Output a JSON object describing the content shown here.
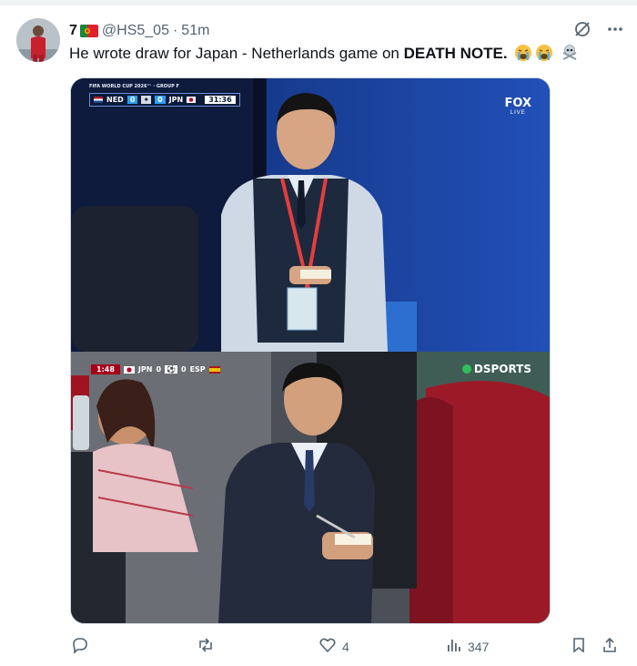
{
  "colors": {
    "text": "#0f1419",
    "muted": "#536471",
    "border": "#cfd9de"
  },
  "post": {
    "display_name": "7",
    "handle": "@HS5_05",
    "separator": "·",
    "time": "51m",
    "text_before": "He wrote draw for Japan - Netherlands game on ",
    "text_bold": "DEATH NOTE.",
    "emojis": [
      "loudly-crying-face",
      "loudly-crying-face",
      "skull-and-crossbones"
    ]
  },
  "media": {
    "top": {
      "broadcast_header": "FIFA WORLD CUP 2026™ · GROUP F",
      "team_home": "NED",
      "score_home": "0",
      "score_away": "0",
      "team_away": "JPN",
      "clock": "31:36",
      "network_logo": "FOX",
      "network_sub": "LIVE"
    },
    "bottom": {
      "clock": "1:48",
      "team_home": "JPN",
      "score_home": "0",
      "score_away": "0",
      "team_away": "ESP",
      "network_logo": "DSPORTS"
    }
  },
  "actions": {
    "replies": "",
    "reposts": "",
    "likes": "4",
    "views": "347"
  },
  "icons": [
    "grok-icon",
    "more-icon",
    "reply-icon",
    "repost-icon",
    "like-icon",
    "views-icon",
    "bookmark-icon",
    "share-icon"
  ]
}
